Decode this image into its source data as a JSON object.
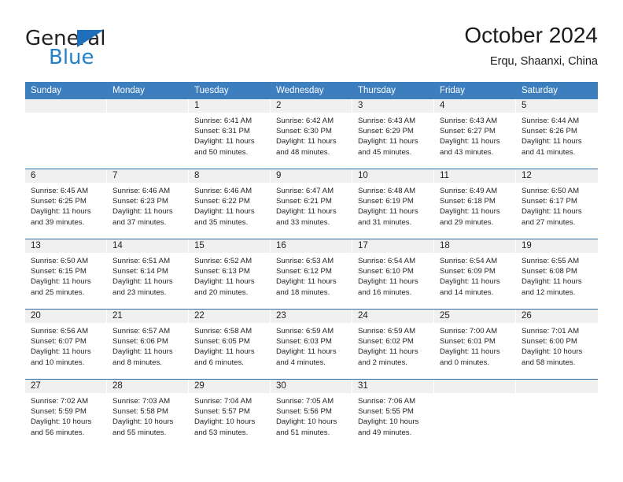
{
  "brand": {
    "name_part1": "General",
    "name_part2": "Blue",
    "triangle_color": "#1f6fbb",
    "blue_color": "#2281c7"
  },
  "header": {
    "title": "October 2024",
    "subtitle": "Erqu, Shaanxi, China"
  },
  "colors": {
    "header_band": "#3d7ebf",
    "week_divider": "#2d6ca8",
    "date_band": "#f0f0f0"
  },
  "weekdays": [
    "Sunday",
    "Monday",
    "Tuesday",
    "Wednesday",
    "Thursday",
    "Friday",
    "Saturday"
  ],
  "weeks": [
    [
      {
        "day": "",
        "sunrise": "",
        "sunset": "",
        "daylight": "",
        "daylight2": ""
      },
      {
        "day": "",
        "sunrise": "",
        "sunset": "",
        "daylight": "",
        "daylight2": ""
      },
      {
        "day": "1",
        "sunrise": "Sunrise: 6:41 AM",
        "sunset": "Sunset: 6:31 PM",
        "daylight": "Daylight: 11 hours",
        "daylight2": "and 50 minutes."
      },
      {
        "day": "2",
        "sunrise": "Sunrise: 6:42 AM",
        "sunset": "Sunset: 6:30 PM",
        "daylight": "Daylight: 11 hours",
        "daylight2": "and 48 minutes."
      },
      {
        "day": "3",
        "sunrise": "Sunrise: 6:43 AM",
        "sunset": "Sunset: 6:29 PM",
        "daylight": "Daylight: 11 hours",
        "daylight2": "and 45 minutes."
      },
      {
        "day": "4",
        "sunrise": "Sunrise: 6:43 AM",
        "sunset": "Sunset: 6:27 PM",
        "daylight": "Daylight: 11 hours",
        "daylight2": "and 43 minutes."
      },
      {
        "day": "5",
        "sunrise": "Sunrise: 6:44 AM",
        "sunset": "Sunset: 6:26 PM",
        "daylight": "Daylight: 11 hours",
        "daylight2": "and 41 minutes."
      }
    ],
    [
      {
        "day": "6",
        "sunrise": "Sunrise: 6:45 AM",
        "sunset": "Sunset: 6:25 PM",
        "daylight": "Daylight: 11 hours",
        "daylight2": "and 39 minutes."
      },
      {
        "day": "7",
        "sunrise": "Sunrise: 6:46 AM",
        "sunset": "Sunset: 6:23 PM",
        "daylight": "Daylight: 11 hours",
        "daylight2": "and 37 minutes."
      },
      {
        "day": "8",
        "sunrise": "Sunrise: 6:46 AM",
        "sunset": "Sunset: 6:22 PM",
        "daylight": "Daylight: 11 hours",
        "daylight2": "and 35 minutes."
      },
      {
        "day": "9",
        "sunrise": "Sunrise: 6:47 AM",
        "sunset": "Sunset: 6:21 PM",
        "daylight": "Daylight: 11 hours",
        "daylight2": "and 33 minutes."
      },
      {
        "day": "10",
        "sunrise": "Sunrise: 6:48 AM",
        "sunset": "Sunset: 6:19 PM",
        "daylight": "Daylight: 11 hours",
        "daylight2": "and 31 minutes."
      },
      {
        "day": "11",
        "sunrise": "Sunrise: 6:49 AM",
        "sunset": "Sunset: 6:18 PM",
        "daylight": "Daylight: 11 hours",
        "daylight2": "and 29 minutes."
      },
      {
        "day": "12",
        "sunrise": "Sunrise: 6:50 AM",
        "sunset": "Sunset: 6:17 PM",
        "daylight": "Daylight: 11 hours",
        "daylight2": "and 27 minutes."
      }
    ],
    [
      {
        "day": "13",
        "sunrise": "Sunrise: 6:50 AM",
        "sunset": "Sunset: 6:15 PM",
        "daylight": "Daylight: 11 hours",
        "daylight2": "and 25 minutes."
      },
      {
        "day": "14",
        "sunrise": "Sunrise: 6:51 AM",
        "sunset": "Sunset: 6:14 PM",
        "daylight": "Daylight: 11 hours",
        "daylight2": "and 23 minutes."
      },
      {
        "day": "15",
        "sunrise": "Sunrise: 6:52 AM",
        "sunset": "Sunset: 6:13 PM",
        "daylight": "Daylight: 11 hours",
        "daylight2": "and 20 minutes."
      },
      {
        "day": "16",
        "sunrise": "Sunrise: 6:53 AM",
        "sunset": "Sunset: 6:12 PM",
        "daylight": "Daylight: 11 hours",
        "daylight2": "and 18 minutes."
      },
      {
        "day": "17",
        "sunrise": "Sunrise: 6:54 AM",
        "sunset": "Sunset: 6:10 PM",
        "daylight": "Daylight: 11 hours",
        "daylight2": "and 16 minutes."
      },
      {
        "day": "18",
        "sunrise": "Sunrise: 6:54 AM",
        "sunset": "Sunset: 6:09 PM",
        "daylight": "Daylight: 11 hours",
        "daylight2": "and 14 minutes."
      },
      {
        "day": "19",
        "sunrise": "Sunrise: 6:55 AM",
        "sunset": "Sunset: 6:08 PM",
        "daylight": "Daylight: 11 hours",
        "daylight2": "and 12 minutes."
      }
    ],
    [
      {
        "day": "20",
        "sunrise": "Sunrise: 6:56 AM",
        "sunset": "Sunset: 6:07 PM",
        "daylight": "Daylight: 11 hours",
        "daylight2": "and 10 minutes."
      },
      {
        "day": "21",
        "sunrise": "Sunrise: 6:57 AM",
        "sunset": "Sunset: 6:06 PM",
        "daylight": "Daylight: 11 hours",
        "daylight2": "and 8 minutes."
      },
      {
        "day": "22",
        "sunrise": "Sunrise: 6:58 AM",
        "sunset": "Sunset: 6:05 PM",
        "daylight": "Daylight: 11 hours",
        "daylight2": "and 6 minutes."
      },
      {
        "day": "23",
        "sunrise": "Sunrise: 6:59 AM",
        "sunset": "Sunset: 6:03 PM",
        "daylight": "Daylight: 11 hours",
        "daylight2": "and 4 minutes."
      },
      {
        "day": "24",
        "sunrise": "Sunrise: 6:59 AM",
        "sunset": "Sunset: 6:02 PM",
        "daylight": "Daylight: 11 hours",
        "daylight2": "and 2 minutes."
      },
      {
        "day": "25",
        "sunrise": "Sunrise: 7:00 AM",
        "sunset": "Sunset: 6:01 PM",
        "daylight": "Daylight: 11 hours",
        "daylight2": "and 0 minutes."
      },
      {
        "day": "26",
        "sunrise": "Sunrise: 7:01 AM",
        "sunset": "Sunset: 6:00 PM",
        "daylight": "Daylight: 10 hours",
        "daylight2": "and 58 minutes."
      }
    ],
    [
      {
        "day": "27",
        "sunrise": "Sunrise: 7:02 AM",
        "sunset": "Sunset: 5:59 PM",
        "daylight": "Daylight: 10 hours",
        "daylight2": "and 56 minutes."
      },
      {
        "day": "28",
        "sunrise": "Sunrise: 7:03 AM",
        "sunset": "Sunset: 5:58 PM",
        "daylight": "Daylight: 10 hours",
        "daylight2": "and 55 minutes."
      },
      {
        "day": "29",
        "sunrise": "Sunrise: 7:04 AM",
        "sunset": "Sunset: 5:57 PM",
        "daylight": "Daylight: 10 hours",
        "daylight2": "and 53 minutes."
      },
      {
        "day": "30",
        "sunrise": "Sunrise: 7:05 AM",
        "sunset": "Sunset: 5:56 PM",
        "daylight": "Daylight: 10 hours",
        "daylight2": "and 51 minutes."
      },
      {
        "day": "31",
        "sunrise": "Sunrise: 7:06 AM",
        "sunset": "Sunset: 5:55 PM",
        "daylight": "Daylight: 10 hours",
        "daylight2": "and 49 minutes."
      },
      {
        "day": "",
        "sunrise": "",
        "sunset": "",
        "daylight": "",
        "daylight2": ""
      },
      {
        "day": "",
        "sunrise": "",
        "sunset": "",
        "daylight": "",
        "daylight2": ""
      }
    ]
  ]
}
